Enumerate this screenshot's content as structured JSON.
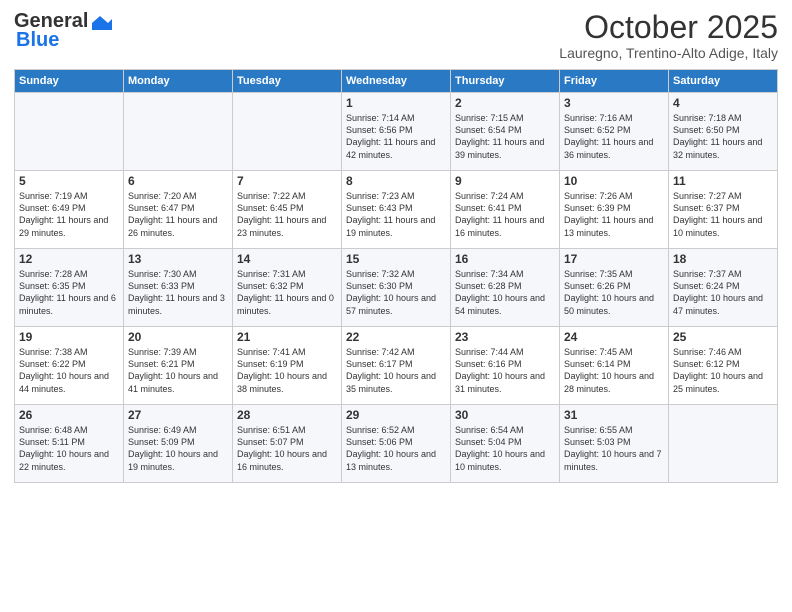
{
  "header": {
    "logo_line1": "General",
    "logo_line2": "Blue",
    "title": "October 2025",
    "subtitle": "Lauregno, Trentino-Alto Adige, Italy"
  },
  "columns": [
    "Sunday",
    "Monday",
    "Tuesday",
    "Wednesday",
    "Thursday",
    "Friday",
    "Saturday"
  ],
  "weeks": [
    [
      {
        "day": "",
        "info": ""
      },
      {
        "day": "",
        "info": ""
      },
      {
        "day": "",
        "info": ""
      },
      {
        "day": "1",
        "info": "Sunrise: 7:14 AM\nSunset: 6:56 PM\nDaylight: 11 hours and 42 minutes."
      },
      {
        "day": "2",
        "info": "Sunrise: 7:15 AM\nSunset: 6:54 PM\nDaylight: 11 hours and 39 minutes."
      },
      {
        "day": "3",
        "info": "Sunrise: 7:16 AM\nSunset: 6:52 PM\nDaylight: 11 hours and 36 minutes."
      },
      {
        "day": "4",
        "info": "Sunrise: 7:18 AM\nSunset: 6:50 PM\nDaylight: 11 hours and 32 minutes."
      }
    ],
    [
      {
        "day": "5",
        "info": "Sunrise: 7:19 AM\nSunset: 6:49 PM\nDaylight: 11 hours and 29 minutes."
      },
      {
        "day": "6",
        "info": "Sunrise: 7:20 AM\nSunset: 6:47 PM\nDaylight: 11 hours and 26 minutes."
      },
      {
        "day": "7",
        "info": "Sunrise: 7:22 AM\nSunset: 6:45 PM\nDaylight: 11 hours and 23 minutes."
      },
      {
        "day": "8",
        "info": "Sunrise: 7:23 AM\nSunset: 6:43 PM\nDaylight: 11 hours and 19 minutes."
      },
      {
        "day": "9",
        "info": "Sunrise: 7:24 AM\nSunset: 6:41 PM\nDaylight: 11 hours and 16 minutes."
      },
      {
        "day": "10",
        "info": "Sunrise: 7:26 AM\nSunset: 6:39 PM\nDaylight: 11 hours and 13 minutes."
      },
      {
        "day": "11",
        "info": "Sunrise: 7:27 AM\nSunset: 6:37 PM\nDaylight: 11 hours and 10 minutes."
      }
    ],
    [
      {
        "day": "12",
        "info": "Sunrise: 7:28 AM\nSunset: 6:35 PM\nDaylight: 11 hours and 6 minutes."
      },
      {
        "day": "13",
        "info": "Sunrise: 7:30 AM\nSunset: 6:33 PM\nDaylight: 11 hours and 3 minutes."
      },
      {
        "day": "14",
        "info": "Sunrise: 7:31 AM\nSunset: 6:32 PM\nDaylight: 11 hours and 0 minutes."
      },
      {
        "day": "15",
        "info": "Sunrise: 7:32 AM\nSunset: 6:30 PM\nDaylight: 10 hours and 57 minutes."
      },
      {
        "day": "16",
        "info": "Sunrise: 7:34 AM\nSunset: 6:28 PM\nDaylight: 10 hours and 54 minutes."
      },
      {
        "day": "17",
        "info": "Sunrise: 7:35 AM\nSunset: 6:26 PM\nDaylight: 10 hours and 50 minutes."
      },
      {
        "day": "18",
        "info": "Sunrise: 7:37 AM\nSunset: 6:24 PM\nDaylight: 10 hours and 47 minutes."
      }
    ],
    [
      {
        "day": "19",
        "info": "Sunrise: 7:38 AM\nSunset: 6:22 PM\nDaylight: 10 hours and 44 minutes."
      },
      {
        "day": "20",
        "info": "Sunrise: 7:39 AM\nSunset: 6:21 PM\nDaylight: 10 hours and 41 minutes."
      },
      {
        "day": "21",
        "info": "Sunrise: 7:41 AM\nSunset: 6:19 PM\nDaylight: 10 hours and 38 minutes."
      },
      {
        "day": "22",
        "info": "Sunrise: 7:42 AM\nSunset: 6:17 PM\nDaylight: 10 hours and 35 minutes."
      },
      {
        "day": "23",
        "info": "Sunrise: 7:44 AM\nSunset: 6:16 PM\nDaylight: 10 hours and 31 minutes."
      },
      {
        "day": "24",
        "info": "Sunrise: 7:45 AM\nSunset: 6:14 PM\nDaylight: 10 hours and 28 minutes."
      },
      {
        "day": "25",
        "info": "Sunrise: 7:46 AM\nSunset: 6:12 PM\nDaylight: 10 hours and 25 minutes."
      }
    ],
    [
      {
        "day": "26",
        "info": "Sunrise: 6:48 AM\nSunset: 5:11 PM\nDaylight: 10 hours and 22 minutes."
      },
      {
        "day": "27",
        "info": "Sunrise: 6:49 AM\nSunset: 5:09 PM\nDaylight: 10 hours and 19 minutes."
      },
      {
        "day": "28",
        "info": "Sunrise: 6:51 AM\nSunset: 5:07 PM\nDaylight: 10 hours and 16 minutes."
      },
      {
        "day": "29",
        "info": "Sunrise: 6:52 AM\nSunset: 5:06 PM\nDaylight: 10 hours and 13 minutes."
      },
      {
        "day": "30",
        "info": "Sunrise: 6:54 AM\nSunset: 5:04 PM\nDaylight: 10 hours and 10 minutes."
      },
      {
        "day": "31",
        "info": "Sunrise: 6:55 AM\nSunset: 5:03 PM\nDaylight: 10 hours and 7 minutes."
      },
      {
        "day": "",
        "info": ""
      }
    ]
  ]
}
